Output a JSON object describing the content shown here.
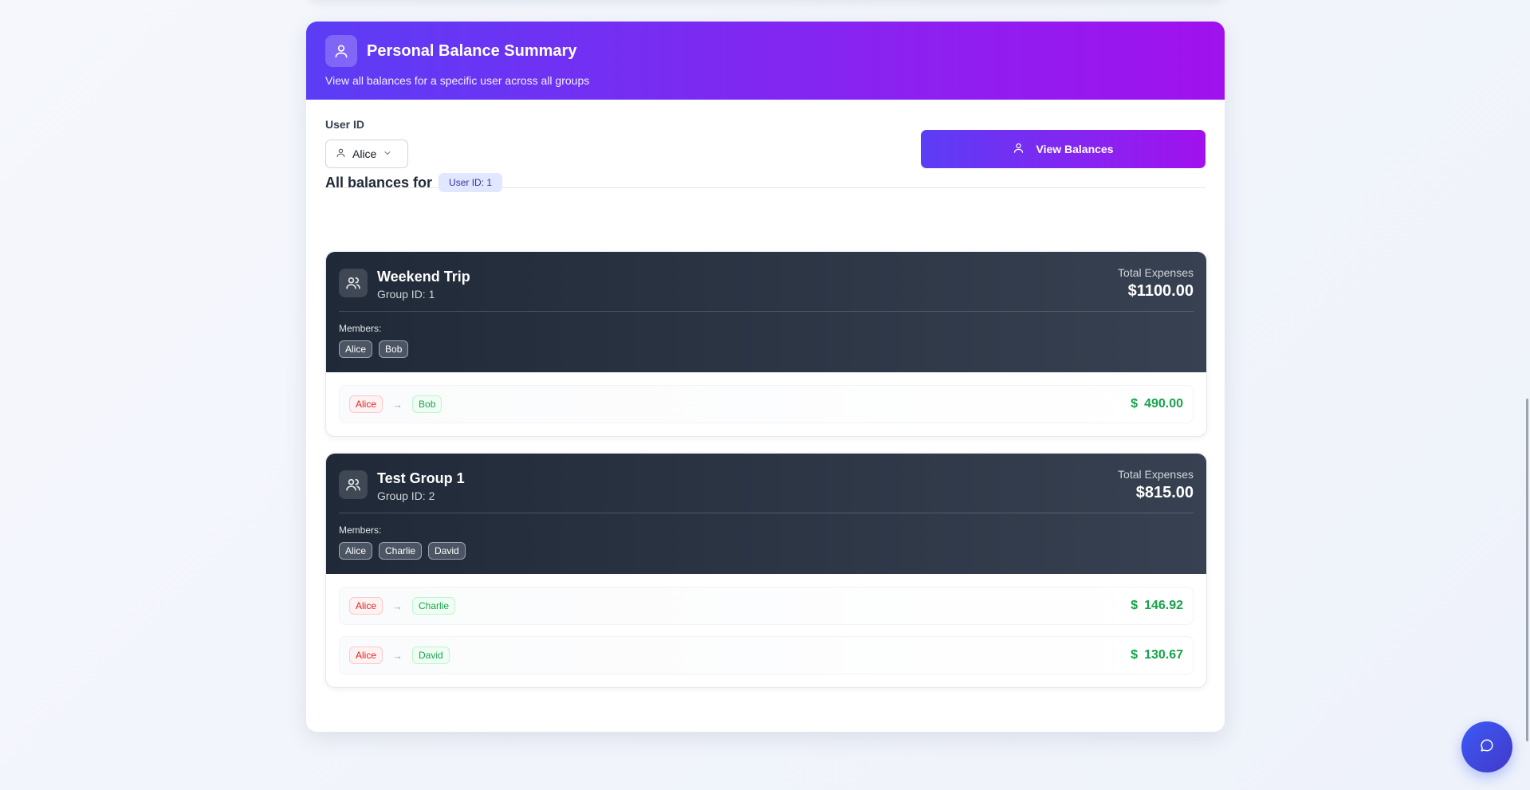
{
  "header": {
    "title": "Personal Balance Summary",
    "subtitle": "View all balances for a specific user across all groups"
  },
  "controls": {
    "user_label": "User ID",
    "selected_user": "Alice",
    "view_button": "View Balances"
  },
  "balances": {
    "title": "All balances for",
    "user_badge": "User ID: 1"
  },
  "groups": [
    {
      "name": "Weekend Trip",
      "id_label": "Group ID: 1",
      "total_label": "Total Expenses",
      "total": "$1100.00",
      "members_label": "Members:",
      "members": [
        "Alice",
        "Bob"
      ],
      "transactions": [
        {
          "from": "Alice",
          "to": "Bob",
          "currency": "$",
          "amount": "490.00"
        }
      ]
    },
    {
      "name": "Test Group 1",
      "id_label": "Group ID: 2",
      "total_label": "Total Expenses",
      "total": "$815.00",
      "members_label": "Members:",
      "members": [
        "Alice",
        "Charlie",
        "David"
      ],
      "transactions": [
        {
          "from": "Alice",
          "to": "Charlie",
          "currency": "$",
          "amount": "146.92"
        },
        {
          "from": "Alice",
          "to": "David",
          "currency": "$",
          "amount": "130.67"
        }
      ]
    }
  ],
  "icons": {
    "header": "user-icon",
    "select": "user-icon",
    "select_chevron": "chevron-down-icon",
    "button": "user-icon",
    "group": "users-icon",
    "arrow": "arrow-right-icon",
    "amount": "dollar-icon",
    "chat": "chat-icon"
  },
  "colors": {
    "gradient_start": "#5b3df5",
    "gradient_end": "#a011ee",
    "group_header": "#1f2937",
    "owed_amount": "#16a34a",
    "debtor_chip": "#dc2626",
    "creditor_chip": "#16a34a"
  }
}
